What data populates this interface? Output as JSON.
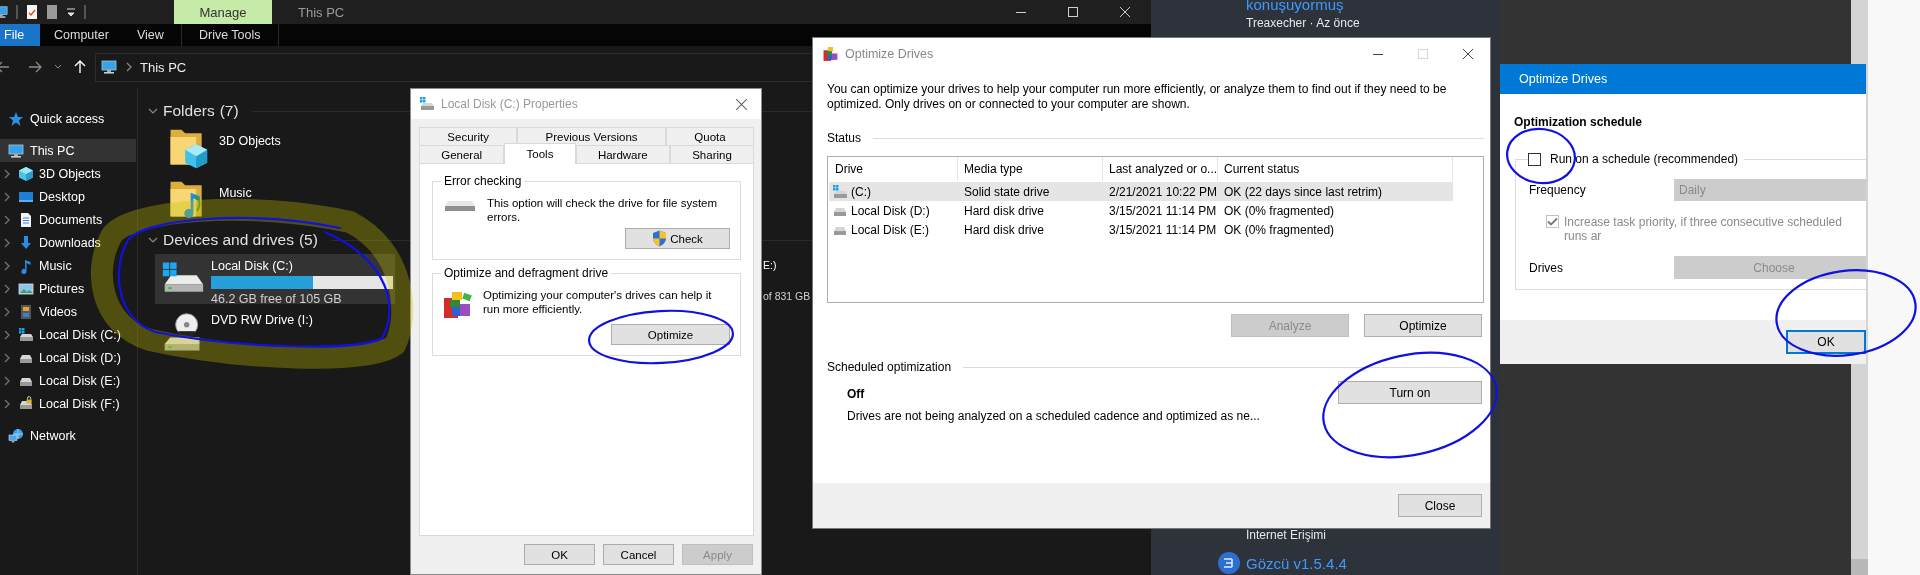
{
  "explorer": {
    "context_tab": "Manage",
    "title": "This PC",
    "ribbon_tabs": [
      {
        "label": "File",
        "kind": "file"
      },
      {
        "label": "Computer",
        "kind": "tab"
      },
      {
        "label": "View",
        "kind": "tab"
      },
      {
        "label": "Drive Tools",
        "kind": "context"
      }
    ],
    "address": "This PC",
    "nav": [
      {
        "label": "Quick access",
        "selected": false
      },
      {
        "label": "This PC",
        "selected": true,
        "children": [
          {
            "label": "3D Objects",
            "selected": false,
            "expanded": false
          },
          {
            "label": "Desktop",
            "selected": false,
            "expanded": false
          },
          {
            "label": "Documents",
            "selected": false,
            "expanded": false
          },
          {
            "label": "Downloads",
            "selected": false,
            "expanded": false
          },
          {
            "label": "Music",
            "selected": false,
            "expanded": false
          },
          {
            "label": "Pictures",
            "selected": false,
            "expanded": false
          },
          {
            "label": "Videos",
            "selected": false,
            "expanded": false
          },
          {
            "label": "Local Disk (C:)",
            "selected": false,
            "expanded": false
          },
          {
            "label": "Local Disk (D:)",
            "selected": false,
            "expanded": false
          },
          {
            "label": "Local Disk (E:)",
            "selected": false,
            "expanded": false
          },
          {
            "label": "Local Disk (F:)",
            "selected": false,
            "expanded": false
          }
        ]
      },
      {
        "label": "Network",
        "selected": false
      }
    ],
    "sections": [
      {
        "title": "Folders",
        "count": "(7)",
        "items": [
          {
            "label": "3D Objects"
          },
          {
            "label": "Music"
          }
        ]
      },
      {
        "title": "Devices and drives",
        "count": "(5)",
        "items": [
          {
            "kind": "disk",
            "label": "Local Disk (C:)",
            "level": 0.56,
            "free": "46.2 GB free of 105 GB",
            "selected": true
          },
          {
            "kind": "optical",
            "label": "DVD RW Drive (I:)",
            "selected": false
          }
        ]
      }
    ],
    "partial_drive": {
      "label": "E:)",
      "free": "of 831 GB"
    }
  },
  "properties": {
    "title": "Local Disk (C:) Properties",
    "tab_rows": [
      {
        "tabs": [
          {
            "label": "Security",
            "selected": false
          },
          {
            "label": "Previous Versions",
            "selected": false
          },
          {
            "label": "Quota",
            "selected": false
          }
        ]
      },
      {
        "tabs": [
          {
            "label": "General",
            "selected": false
          },
          {
            "label": "Tools",
            "selected": true
          },
          {
            "label": "Hardware",
            "selected": false
          },
          {
            "label": "Sharing",
            "selected": false
          }
        ]
      }
    ],
    "groups": [
      {
        "title": "Error checking",
        "text": "This option will check the drive for file system errors.",
        "button": "Check"
      },
      {
        "title": "Optimize and defragment drive",
        "text": "Optimizing your computer's drives can help it run more efficiently.",
        "button": "Optimize"
      }
    ],
    "buttons": [
      {
        "label": "OK",
        "disabled": false
      },
      {
        "label": "Cancel",
        "disabled": false
      },
      {
        "label": "Apply",
        "disabled": true
      }
    ]
  },
  "optimize": {
    "title": "Optimize Drives",
    "maximize_disabled": true,
    "intro": "You can optimize your drives to help your computer run more efficiently, or analyze them to find out if they need to be optimized. Only drives on or connected to your computer are shown.",
    "status_label": "Status",
    "columns": [
      "Drive",
      "Media type",
      "Last analyzed or o...",
      "Current status"
    ],
    "rows": [
      {
        "drive": "(C:)",
        "media": "Solid state drive",
        "last": "2/21/2021 10:22 PM",
        "status": "OK (22 days since last retrim)",
        "selected": true
      },
      {
        "drive": "Local Disk (D:)",
        "media": "Hard disk drive",
        "last": "3/15/2021 11:14 PM",
        "status": "OK (0% fragmented)",
        "selected": false
      },
      {
        "drive": "Local Disk (E:)",
        "media": "Hard disk drive",
        "last": "3/15/2021 11:14 PM",
        "status": "OK (0% fragmented)",
        "selected": false
      }
    ],
    "actions": [
      {
        "label": "Analyze",
        "disabled": true
      },
      {
        "label": "Optimize",
        "disabled": false
      }
    ],
    "schedule": {
      "title": "Scheduled optimization",
      "state": "Off",
      "text": "Drives are not being analyzed on a scheduled cadence and optimized as ne...",
      "button": "Turn on"
    },
    "close": "Close"
  },
  "schedule_dialog": {
    "title": "Optimize Drives",
    "heading": "Optimization schedule",
    "run_on_schedule": {
      "label": "Run on a schedule (recommended)",
      "checked": false
    },
    "frequency": {
      "label": "Frequency",
      "value": "Daily",
      "disabled": true
    },
    "priority": {
      "label": "Increase task priority, if three consecutive scheduled runs ar",
      "checked": true,
      "disabled": true
    },
    "drives": {
      "label": "Drives",
      "button": "Choose",
      "disabled": true
    },
    "ok": "OK"
  },
  "chat": {
    "link": "konuşuyormuş",
    "meta": "Treaxecher · Az önce",
    "item": "İnternet Erişimi",
    "app": "Gözcü v1.5.4.4"
  },
  "pen_marks": [
    {
      "kind": "highlighter"
    },
    {
      "kind": "pen"
    },
    {
      "kind": "pen"
    },
    {
      "kind": "pen"
    },
    {
      "kind": "pen"
    },
    {
      "kind": "pen"
    }
  ]
}
